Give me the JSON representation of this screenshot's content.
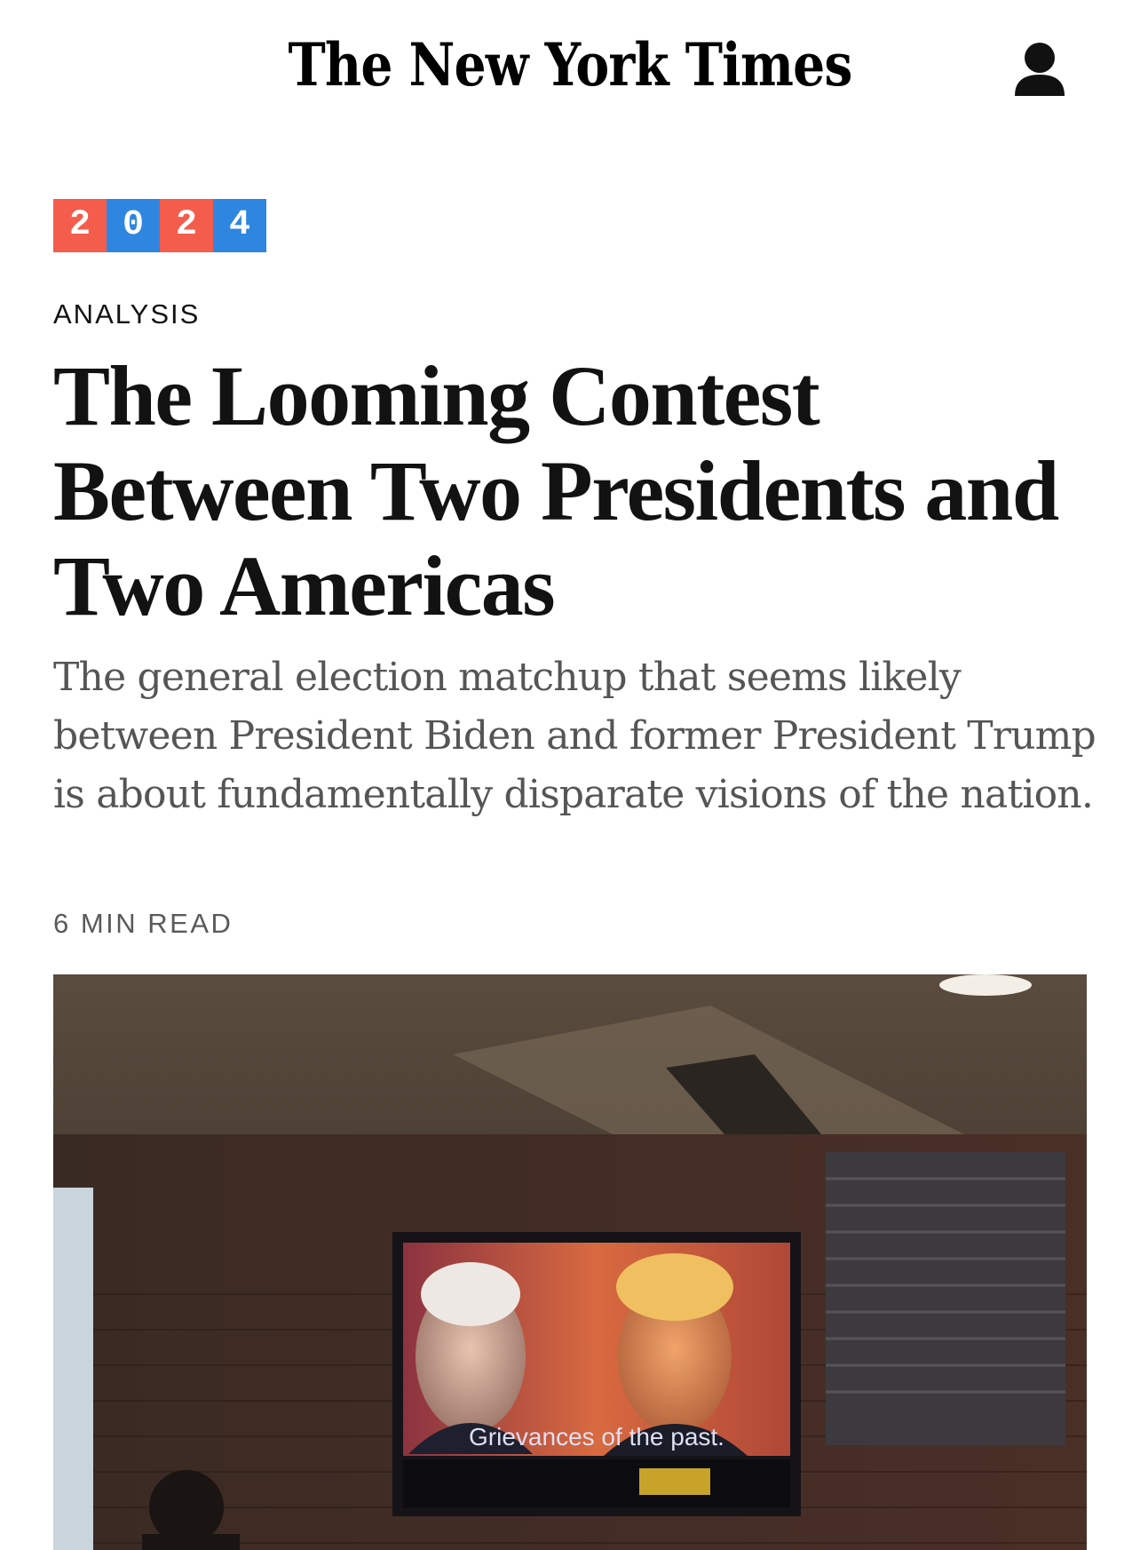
{
  "header": {
    "masthead": "The New York Times",
    "account_icon": "person-icon"
  },
  "article": {
    "badge": {
      "digits": [
        "2",
        "0",
        "2",
        "4"
      ],
      "colors": [
        "#f45d4c",
        "#2f86e0",
        "#f45d4c",
        "#2f86e0"
      ]
    },
    "kicker": "ANALYSIS",
    "headline": "The Looming Contest Between Two Presidents and Two Americas",
    "summary": "The general election matchup that seems likely between President Biden and former President Trump is about fundamentally disparate visions of the nation.",
    "read_time": "6 MIN READ",
    "image": {
      "caption_on_tv": "Grievances of the past."
    }
  }
}
